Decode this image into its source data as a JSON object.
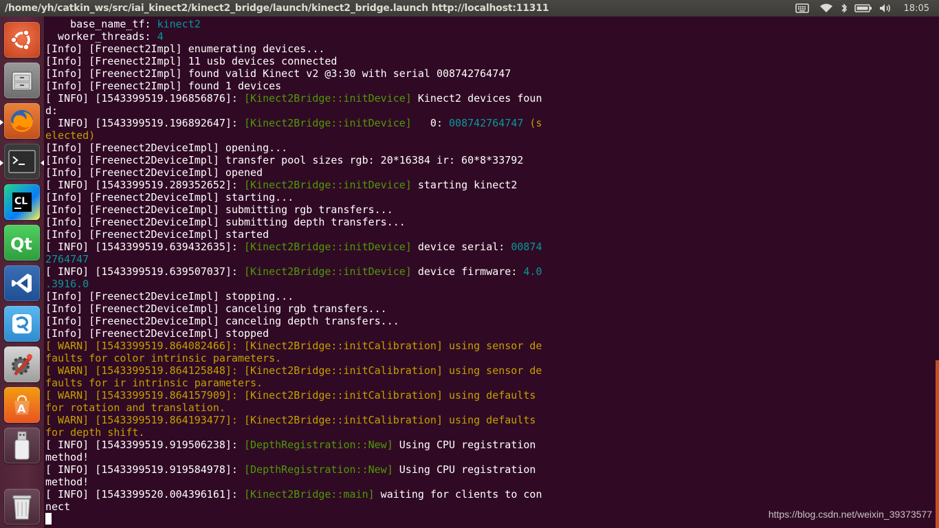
{
  "window": {
    "title": "/home/yh/catkin_ws/src/iai_kinect2/kinect2_bridge/launch/kinect2_bridge.launch http://localhost:11311"
  },
  "panel": {
    "clock": "18:05",
    "indicators": [
      "keyboard-icon",
      "wifi-icon",
      "bluetooth-icon",
      "battery-icon",
      "volume-icon"
    ]
  },
  "launcher": {
    "items": [
      {
        "name": "ubuntu-dash",
        "icon": "ubuntu-logo-icon",
        "color": "#e95420"
      },
      {
        "name": "files",
        "icon": "file-cabinet-icon",
        "color": "#8a8a8a"
      },
      {
        "name": "firefox",
        "icon": "firefox-icon",
        "color": "#e66000"
      },
      {
        "name": "terminal",
        "icon": "terminal-icon",
        "color": "#2c2c2c"
      },
      {
        "name": "clion",
        "icon": "clion-icon",
        "color": "#21d789",
        "label": "CL"
      },
      {
        "name": "qt-creator",
        "icon": "qt-icon",
        "color": "#41cd52",
        "label": "Qt"
      },
      {
        "name": "vscode",
        "icon": "vscode-icon",
        "color": "#007acc"
      },
      {
        "name": "wps",
        "icon": "wps-icon",
        "color": "#2e9be5"
      },
      {
        "name": "system-settings",
        "icon": "settings-icon",
        "color": "#c0392b"
      },
      {
        "name": "software-center",
        "icon": "shopping-bag-icon",
        "color": "#e95420",
        "label": "A"
      },
      {
        "name": "usb-drive",
        "icon": "usb-drive-icon",
        "color": "#d8d8d8"
      },
      {
        "name": "trash",
        "icon": "trash-icon",
        "color": "#cfcfcf"
      }
    ]
  },
  "terminal": {
    "lines": [
      [
        {
          "t": "    base_name_tf: "
        },
        {
          "t": "kinect2",
          "c": "cyan"
        }
      ],
      [
        {
          "t": "  worker_threads: "
        },
        {
          "t": "4",
          "c": "cyan"
        }
      ],
      [
        {
          "t": "[Info] [Freenect2Impl] enumerating devices..."
        }
      ],
      [
        {
          "t": "[Info] [Freenect2Impl] 11 usb devices connected"
        }
      ],
      [
        {
          "t": "[Info] [Freenect2Impl] found valid Kinect v2 @3:30 with serial 008742764747"
        }
      ],
      [
        {
          "t": "[Info] [Freenect2Impl] found 1 devices"
        }
      ],
      [
        {
          "t": "[ INFO] [1543399519.196856876]: "
        },
        {
          "t": "[Kinect2Bridge::initDevice]",
          "c": "green"
        },
        {
          "t": " Kinect2 devices foun"
        }
      ],
      [
        {
          "t": "d:"
        }
      ],
      [
        {
          "t": "[ INFO] [1543399519.196892647]: "
        },
        {
          "t": "[Kinect2Bridge::initDevice]",
          "c": "green"
        },
        {
          "t": "   0: "
        },
        {
          "t": "008742764747",
          "c": "cyan"
        },
        {
          "t": " (s",
          "c": "warn"
        }
      ],
      [
        {
          "t": "elected)",
          "c": "warn"
        }
      ],
      [
        {
          "t": "[Info] [Freenect2DeviceImpl] opening..."
        }
      ],
      [
        {
          "t": "[Info] [Freenect2DeviceImpl] transfer pool sizes rgb: 20*16384 ir: 60*8*33792"
        }
      ],
      [
        {
          "t": "[Info] [Freenect2DeviceImpl] opened"
        }
      ],
      [
        {
          "t": "[ INFO] [1543399519.289352652]: "
        },
        {
          "t": "[Kinect2Bridge::initDevice]",
          "c": "green"
        },
        {
          "t": " starting kinect2"
        }
      ],
      [
        {
          "t": "[Info] [Freenect2DeviceImpl] starting..."
        }
      ],
      [
        {
          "t": "[Info] [Freenect2DeviceImpl] submitting rgb transfers..."
        }
      ],
      [
        {
          "t": "[Info] [Freenect2DeviceImpl] submitting depth transfers..."
        }
      ],
      [
        {
          "t": "[Info] [Freenect2DeviceImpl] started"
        }
      ],
      [
        {
          "t": "[ INFO] [1543399519.639432635]: "
        },
        {
          "t": "[Kinect2Bridge::initDevice]",
          "c": "green"
        },
        {
          "t": " device serial: "
        },
        {
          "t": "00874",
          "c": "cyan"
        }
      ],
      [
        {
          "t": "2764747",
          "c": "cyan"
        }
      ],
      [
        {
          "t": "[ INFO] [1543399519.639507037]: "
        },
        {
          "t": "[Kinect2Bridge::initDevice]",
          "c": "green"
        },
        {
          "t": " device firmware: "
        },
        {
          "t": "4.0",
          "c": "cyan"
        }
      ],
      [
        {
          "t": ".3916.0",
          "c": "cyan"
        }
      ],
      [
        {
          "t": "[Info] [Freenect2DeviceImpl] stopping..."
        }
      ],
      [
        {
          "t": "[Info] [Freenect2DeviceImpl] canceling rgb transfers..."
        }
      ],
      [
        {
          "t": "[Info] [Freenect2DeviceImpl] canceling depth transfers..."
        }
      ],
      [
        {
          "t": "[Info] [Freenect2DeviceImpl] stopped"
        }
      ],
      [
        {
          "t": "[ WARN] [1543399519.864082466]: [Kinect2Bridge::initCalibration] using sensor de",
          "c": "warn"
        }
      ],
      [
        {
          "t": "faults for color intrinsic parameters.",
          "c": "warn"
        }
      ],
      [
        {
          "t": "[ WARN] [1543399519.864125848]: [Kinect2Bridge::initCalibration] using sensor de",
          "c": "warn"
        }
      ],
      [
        {
          "t": "faults for ir intrinsic parameters.",
          "c": "warn"
        }
      ],
      [
        {
          "t": "[ WARN] [1543399519.864157909]: [Kinect2Bridge::initCalibration] using defaults",
          "c": "warn"
        }
      ],
      [
        {
          "t": "for rotation and translation.",
          "c": "warn"
        }
      ],
      [
        {
          "t": "[ WARN] [1543399519.864193477]: [Kinect2Bridge::initCalibration] using defaults",
          "c": "warn"
        }
      ],
      [
        {
          "t": "for depth shift.",
          "c": "warn"
        }
      ],
      [
        {
          "t": "[ INFO] [1543399519.919506238]: "
        },
        {
          "t": "[DepthRegistration::New]",
          "c": "green"
        },
        {
          "t": " Using CPU registration"
        }
      ],
      [
        {
          "t": "method!"
        }
      ],
      [
        {
          "t": "[ INFO] [1543399519.919584978]: "
        },
        {
          "t": "[DepthRegistration::New]",
          "c": "green"
        },
        {
          "t": " Using CPU registration"
        }
      ],
      [
        {
          "t": "method!"
        }
      ],
      [
        {
          "t": "[ INFO] [1543399520.004396161]: "
        },
        {
          "t": "[Kinect2Bridge::main]",
          "c": "green"
        },
        {
          "t": " waiting for clients to con"
        }
      ],
      [
        {
          "t": "nect"
        }
      ]
    ]
  },
  "watermark": "https://blog.csdn.net/weixin_39373577"
}
